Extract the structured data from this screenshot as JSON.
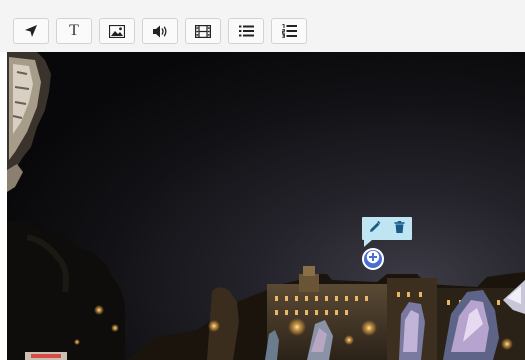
{
  "toolbar": {
    "tools": [
      {
        "name": "arrow-tool",
        "icon": "navigation-arrow-icon"
      },
      {
        "name": "text-tool",
        "icon": "text-icon",
        "glyph": "T"
      },
      {
        "name": "image-tool",
        "icon": "image-icon"
      },
      {
        "name": "audio-tool",
        "icon": "speaker-icon"
      },
      {
        "name": "video-tool",
        "icon": "film-icon"
      },
      {
        "name": "list-tool",
        "icon": "bulleted-list-icon"
      },
      {
        "name": "numbered-list-tool",
        "icon": "numbered-list-icon"
      }
    ]
  },
  "hotspot": {
    "actions": [
      {
        "name": "edit",
        "icon": "pencil-icon"
      },
      {
        "name": "delete",
        "icon": "trash-icon"
      }
    ],
    "add_icon": "plus-circle-icon"
  },
  "colors": {
    "toolbar_bg": "#f4f4f4",
    "hotspot_toolbar_bg": "#bfe4f2",
    "hotspot_icon": "#1a5a8a",
    "hotspot_marker": "#4a6fd1"
  }
}
